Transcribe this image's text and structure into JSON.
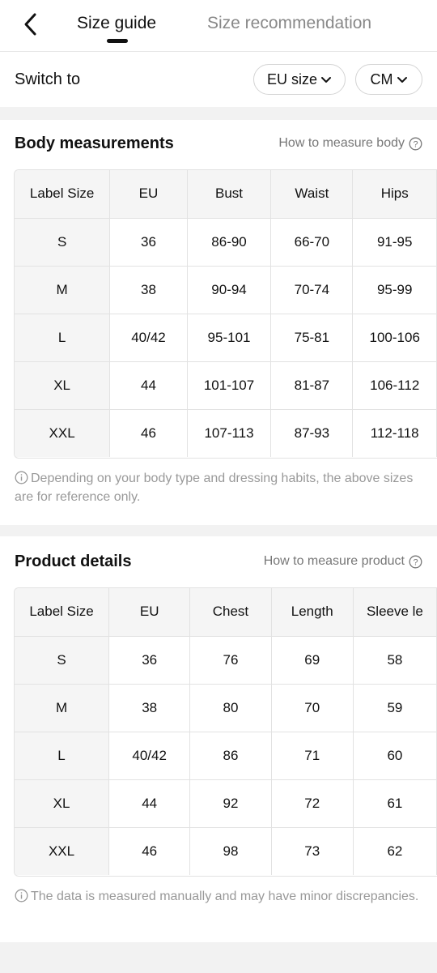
{
  "header": {
    "tabs": [
      {
        "label": "Size guide",
        "active": true
      },
      {
        "label": "Size recommendation",
        "active": false
      }
    ]
  },
  "switcher": {
    "label": "Switch to",
    "size_system": "EU size",
    "unit": "CM"
  },
  "body_measurements": {
    "title": "Body measurements",
    "link": "How to measure body",
    "columns": [
      "Label Size",
      "EU",
      "Bust",
      "Waist",
      "Hips"
    ],
    "rows": [
      [
        "S",
        "36",
        "86-90",
        "66-70",
        "91-95"
      ],
      [
        "M",
        "38",
        "90-94",
        "70-74",
        "95-99"
      ],
      [
        "L",
        "40/42",
        "95-101",
        "75-81",
        "100-106"
      ],
      [
        "XL",
        "44",
        "101-107",
        "81-87",
        "106-112"
      ],
      [
        "XXL",
        "46",
        "107-113",
        "87-93",
        "112-118"
      ]
    ],
    "note": "Depending on your body type and dressing habits, the above sizes are for reference only."
  },
  "product_details": {
    "title": "Product details",
    "link": "How to measure product",
    "columns": [
      "Label Size",
      "EU",
      "Chest",
      "Length",
      "Sleeve le"
    ],
    "rows": [
      [
        "S",
        "36",
        "76",
        "69",
        "58"
      ],
      [
        "M",
        "38",
        "80",
        "70",
        "59"
      ],
      [
        "L",
        "40/42",
        "86",
        "71",
        "60"
      ],
      [
        "XL",
        "44",
        "92",
        "72",
        "61"
      ],
      [
        "XXL",
        "46",
        "98",
        "73",
        "62"
      ]
    ],
    "note": "The data is measured manually and may have minor discrepancies."
  },
  "colors": {
    "text": "#111111",
    "muted": "#888888",
    "divider": "#f2f2f2",
    "header_cell": "#f5f5f5"
  },
  "icons": [
    "back-arrow-icon",
    "chevron-down-icon",
    "help-circle-icon",
    "info-circle-icon"
  ]
}
